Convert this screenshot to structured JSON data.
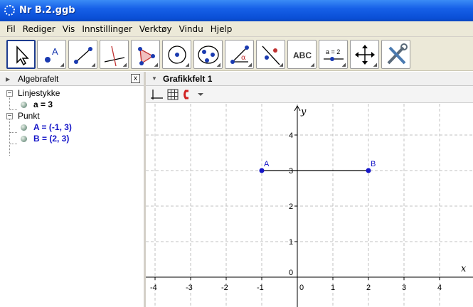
{
  "window": {
    "title": "Nr B.2.ggb"
  },
  "menu": [
    "Fil",
    "Rediger",
    "Vis",
    "Innstillinger",
    "Verktøy",
    "Vindu",
    "Hjelp"
  ],
  "toolbar": {
    "tools": [
      "move-tool",
      "point-tool",
      "line-tool",
      "perpendicular-line-tool",
      "polygon-tool",
      "circle-tool",
      "conic-tool",
      "angle-tool",
      "reflect-tool",
      "text-tool",
      "slider-tool",
      "move-graphics-view-tool",
      "properties-tool"
    ],
    "text_tool_label": "ABC",
    "slider_tool_label": "a = 2"
  },
  "algebra": {
    "title": "Algebrafelt",
    "close_label": "x",
    "groups": [
      {
        "name": "Linjestykke",
        "items": [
          "a = 3"
        ]
      },
      {
        "name": "Punkt",
        "items": [
          "A = (-1, 3)",
          "B = (2, 3)"
        ]
      }
    ]
  },
  "graphics": {
    "title": "Grafikkfelt 1",
    "x_axis_label": "x",
    "y_axis_label": "y",
    "x_ticks": [
      "-4",
      "-3",
      "-2",
      "-1",
      "0",
      "1",
      "2",
      "3",
      "4"
    ],
    "y_ticks": [
      "0",
      "1",
      "2",
      "3",
      "4"
    ],
    "points": [
      {
        "label": "A",
        "x": -1,
        "y": 3
      },
      {
        "label": "B",
        "x": 2,
        "y": 3
      }
    ],
    "point_color": "#1515c8"
  }
}
